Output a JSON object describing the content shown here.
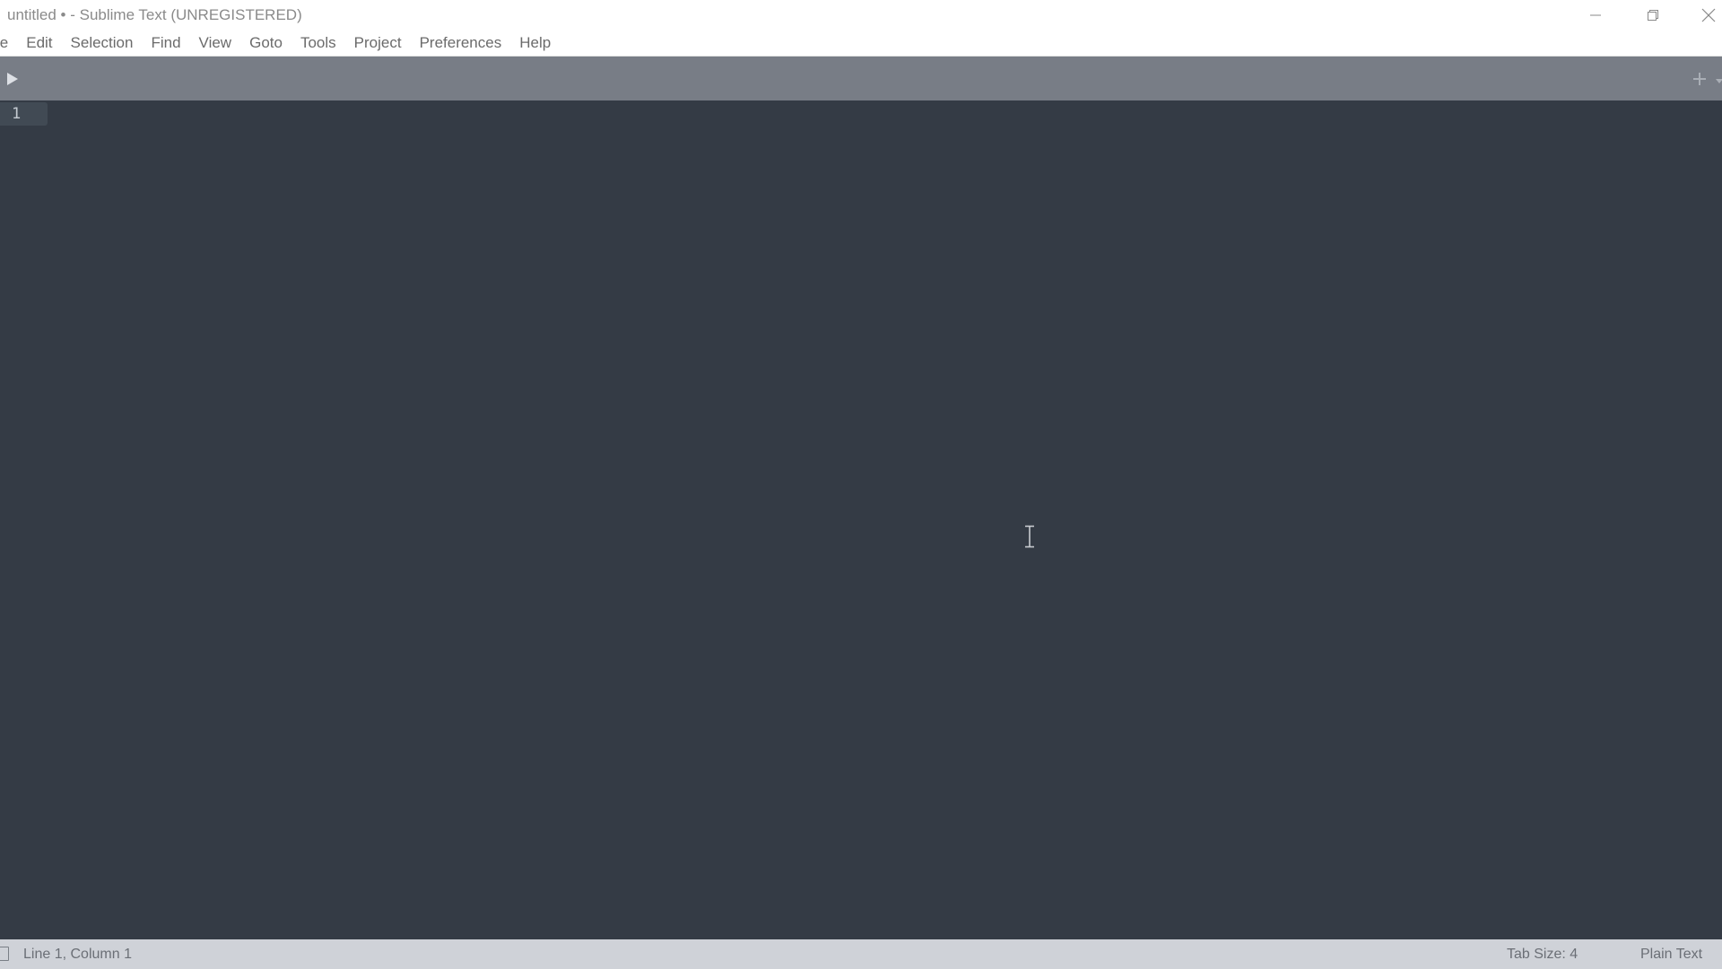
{
  "window": {
    "title": "untitled • - Sublime Text (UNREGISTERED)",
    "controls": {
      "minimize": "minimize-icon",
      "restore": "restore-icon",
      "close": "close-icon"
    }
  },
  "menubar": {
    "items": [
      {
        "label": "File",
        "visible_label": "le"
      },
      {
        "label": "Edit"
      },
      {
        "label": "Selection"
      },
      {
        "label": "Find"
      },
      {
        "label": "View"
      },
      {
        "label": "Goto"
      },
      {
        "label": "Tools"
      },
      {
        "label": "Project"
      },
      {
        "label": "Preferences"
      },
      {
        "label": "Help"
      }
    ]
  },
  "tabbar": {
    "sidebar_toggle_icon": "play-triangle-icon",
    "new_tab_icon": "plus-icon",
    "tab_list_icon": "chevron-down-icon"
  },
  "editor": {
    "lines": [
      {
        "number": "1",
        "text": ""
      }
    ],
    "cursor": "ibeam-cursor"
  },
  "statusbar": {
    "position": "Line 1, Column 1",
    "tab_size": "Tab Size: 4",
    "syntax": "Plain Text"
  },
  "colors": {
    "editor_bg": "#343b45",
    "tabbar_bg": "#787d86",
    "statusbar_bg": "#cfd2d8",
    "gutter_highlight": "#414a54"
  }
}
